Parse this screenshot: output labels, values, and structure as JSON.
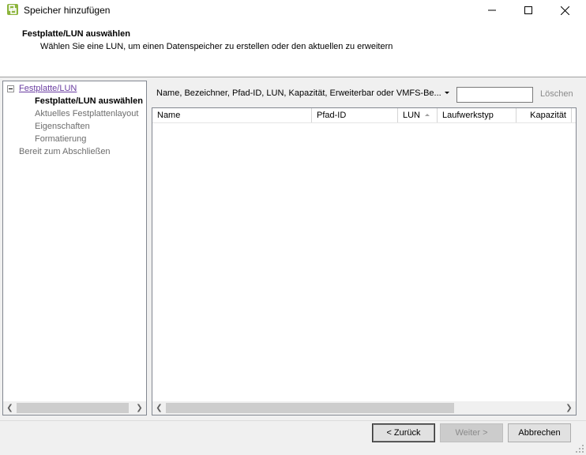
{
  "window": {
    "title": "Speicher hinzufügen",
    "icon": "vsphere-app-icon"
  },
  "header": {
    "title": "Festplatte/LUN auswählen",
    "subtitle": "Wählen Sie eine LUN, um einen Datenspeicher zu erstellen oder den aktuellen zu erweitern"
  },
  "nav": {
    "section": "Festplatte/LUN",
    "current": "Festplatte/LUN auswählen",
    "steps": [
      "Aktuelles Festplattenlayout",
      "Eigenschaften",
      "Formatierung"
    ],
    "final": "Bereit zum Abschließen"
  },
  "filter": {
    "label": "Name, Bezeichner, Pfad-ID, LUN, Kapazität, Erweiterbar oder VMFS-Be...",
    "value": "",
    "clear_label": "Löschen"
  },
  "table": {
    "columns": [
      "Name",
      "Pfad-ID",
      "LUN",
      "Laufwerkstyp",
      "Kapazität"
    ],
    "sorted_column": "LUN",
    "rows": []
  },
  "buttons": {
    "back": "< Zurück",
    "next": "Weiter >",
    "cancel": "Abbrechen"
  }
}
